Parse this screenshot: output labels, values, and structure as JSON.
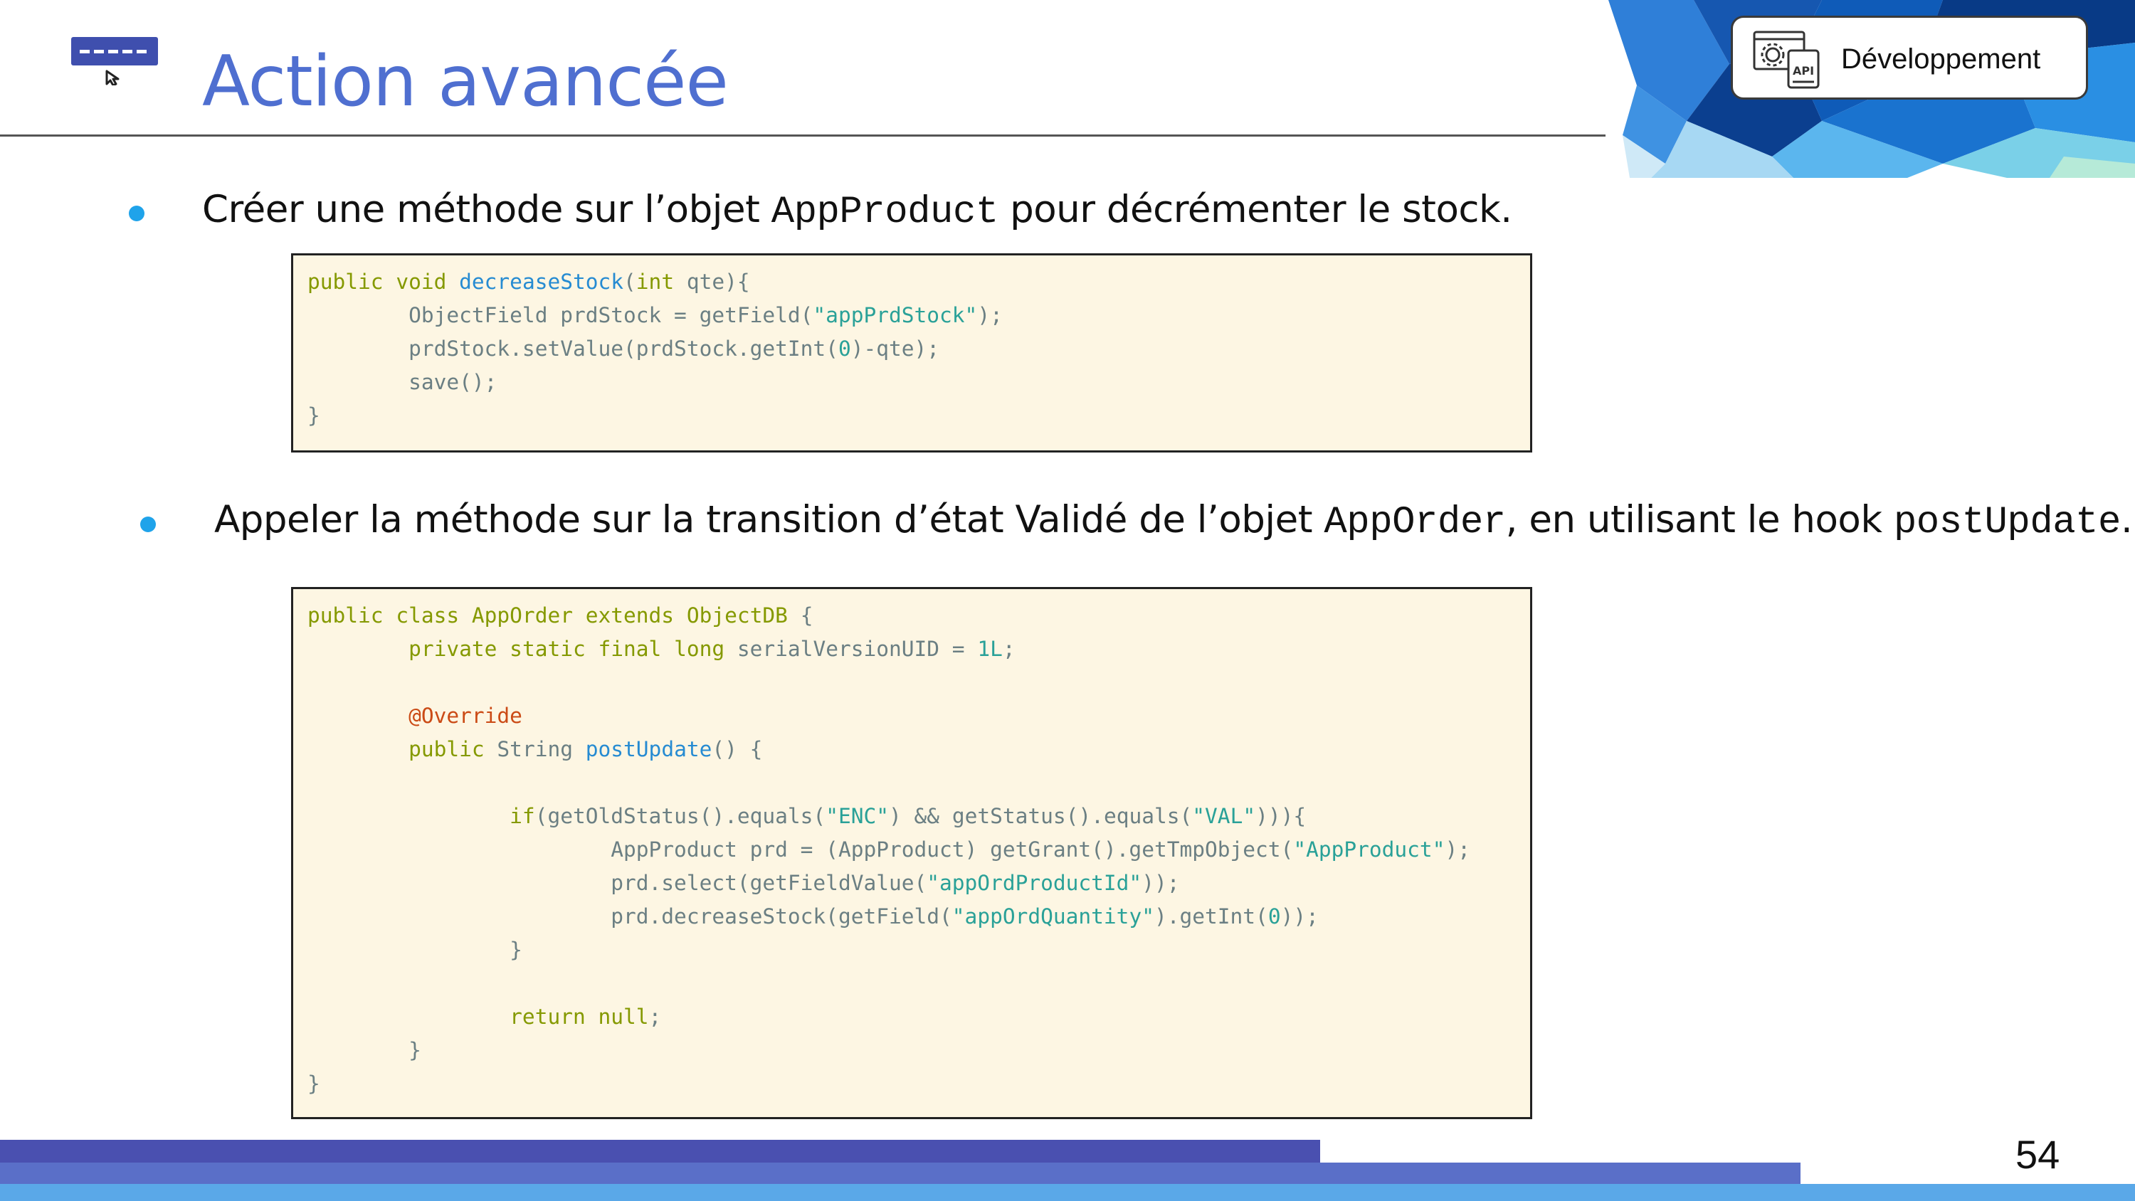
{
  "header": {
    "title": "Action avancée",
    "category_badge": "Développement",
    "slide_icon": "action-button-cursor-icon",
    "badge_icon": "api-settings-icon"
  },
  "bullets": [
    {
      "text_before": "Créer une méthode sur l’objet ",
      "code": "AppProduct",
      "text_after": "  pour décrémenter le stock."
    },
    {
      "text_before": "Appeler la méthode sur la transition d’état Validé de l’objet ",
      "code1": "AppOrder",
      "text_middle": ", en utilisant le hook ",
      "code2": "postUpdate",
      "text_after": "."
    }
  ],
  "code_blocks": [
    {
      "lines": [
        [
          [
            "kw",
            "public void "
          ],
          [
            "fn",
            "decreaseStock"
          ],
          [
            "p",
            "("
          ],
          [
            "kw",
            "int"
          ],
          [
            "p",
            " qte){"
          ]
        ],
        [
          [
            "p",
            "        ObjectField prdStock = getField("
          ],
          [
            "str",
            "\"appPrdStock\""
          ],
          [
            "p",
            ");"
          ]
        ],
        [
          [
            "p",
            "        prdStock.setValue(prdStock.getInt("
          ],
          [
            "num",
            "0"
          ],
          [
            "p",
            ")-qte);"
          ]
        ],
        [
          [
            "p",
            "        save();"
          ]
        ],
        [
          [
            "p",
            "}"
          ]
        ]
      ]
    },
    {
      "lines": [
        [
          [
            "kw",
            "public class "
          ],
          [
            "kw",
            "AppOrder"
          ],
          [
            "kw",
            " extends "
          ],
          [
            "kw",
            "ObjectDB"
          ],
          [
            "p",
            " {"
          ]
        ],
        [
          [
            "p",
            "        "
          ],
          [
            "kw",
            "private static final long "
          ],
          [
            "p",
            "serialVersionUID = "
          ],
          [
            "num",
            "1L"
          ],
          [
            "p",
            ";"
          ]
        ],
        [
          [
            "p",
            ""
          ]
        ],
        [
          [
            "p",
            "        "
          ],
          [
            "ann",
            "@Override"
          ]
        ],
        [
          [
            "p",
            "        "
          ],
          [
            "kw",
            "public "
          ],
          [
            "p",
            "String "
          ],
          [
            "fn",
            "postUpdate"
          ],
          [
            "p",
            "() {"
          ]
        ],
        [
          [
            "p",
            ""
          ]
        ],
        [
          [
            "p",
            "                "
          ],
          [
            "kw",
            "if"
          ],
          [
            "p",
            "(getOldStatus().equals("
          ],
          [
            "str",
            "\"ENC\""
          ],
          [
            "p",
            ") && getStatus().equals("
          ],
          [
            "str",
            "\"VAL\""
          ],
          [
            "p",
            "))){"
          ]
        ],
        [
          [
            "p",
            "                        AppProduct prd = (AppProduct) getGrant().getTmpObject("
          ],
          [
            "str",
            "\"AppProduct\""
          ],
          [
            "p",
            ");"
          ]
        ],
        [
          [
            "p",
            "                        prd.select(getFieldValue("
          ],
          [
            "str",
            "\"appOrdProductId\""
          ],
          [
            "p",
            "));"
          ]
        ],
        [
          [
            "p",
            "                        prd.decreaseStock(getField("
          ],
          [
            "str",
            "\"appOrdQuantity\""
          ],
          [
            "p",
            ").getInt("
          ],
          [
            "num",
            "0"
          ],
          [
            "p",
            "));"
          ]
        ],
        [
          [
            "p",
            "                }"
          ]
        ],
        [
          [
            "p",
            ""
          ]
        ],
        [
          [
            "p",
            "                "
          ],
          [
            "kw",
            "return null"
          ],
          [
            "p",
            ";"
          ]
        ],
        [
          [
            "p",
            "        }"
          ]
        ],
        [
          [
            "p",
            "}"
          ]
        ]
      ]
    }
  ],
  "footer": {
    "page_number": "54"
  },
  "colors": {
    "title": "#4f6fd0",
    "bullet": "#1fa3ea",
    "code_background": "#fdf6e3",
    "footer_dark": "#4a50b0",
    "footer_mid": "#5a6fc8",
    "footer_light": "#5aa8e8"
  }
}
